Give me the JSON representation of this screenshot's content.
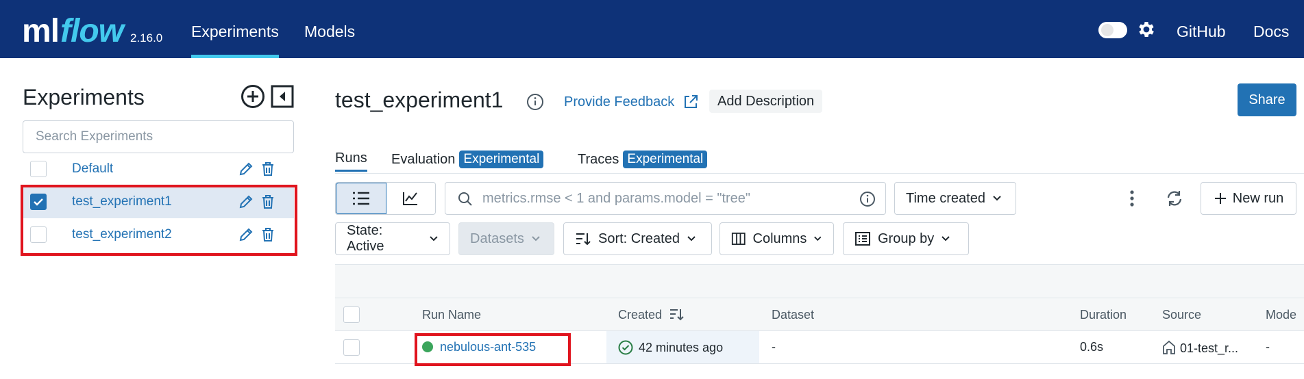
{
  "nav": {
    "logo_ml": "ml",
    "logo_flow": "flow",
    "version": "2.16.0",
    "experiments": "Experiments",
    "models": "Models",
    "github": "GitHub",
    "docs": "Docs"
  },
  "sidebar": {
    "title": "Experiments",
    "search_placeholder": "Search Experiments",
    "experiments": [
      {
        "name": "Default",
        "checked": false
      },
      {
        "name": "test_experiment1",
        "checked": true
      },
      {
        "name": "test_experiment2",
        "checked": false
      }
    ]
  },
  "main": {
    "title": "test_experiment1",
    "feedback": "Provide Feedback",
    "add_description": "Add Description",
    "share": "Share",
    "tabs": {
      "runs": "Runs",
      "evaluation": "Evaluation",
      "traces": "Traces",
      "badge": "Experimental"
    },
    "toolbar": {
      "search_placeholder": "metrics.rmse < 1 and params.model = \"tree\"",
      "time_created": "Time created",
      "new_run": "New run",
      "state": "State: Active",
      "datasets": "Datasets",
      "sort": "Sort: Created",
      "columns": "Columns",
      "group_by": "Group by"
    },
    "table": {
      "headers": {
        "run_name": "Run Name",
        "created": "Created",
        "dataset": "Dataset",
        "duration": "Duration",
        "source": "Source",
        "models": "Mode"
      },
      "rows": [
        {
          "run_name": "nebulous-ant-535",
          "created": "42 minutes ago",
          "dataset": "-",
          "duration": "0.6s",
          "source": "01-test_r...",
          "models": "-"
        }
      ]
    }
  },
  "colors": {
    "nav_bg": "#0e3278",
    "accent": "#2272b4",
    "nav_underline": "#43c9ed",
    "highlight": "#e0141e",
    "status_finished": "#3ba55c"
  }
}
